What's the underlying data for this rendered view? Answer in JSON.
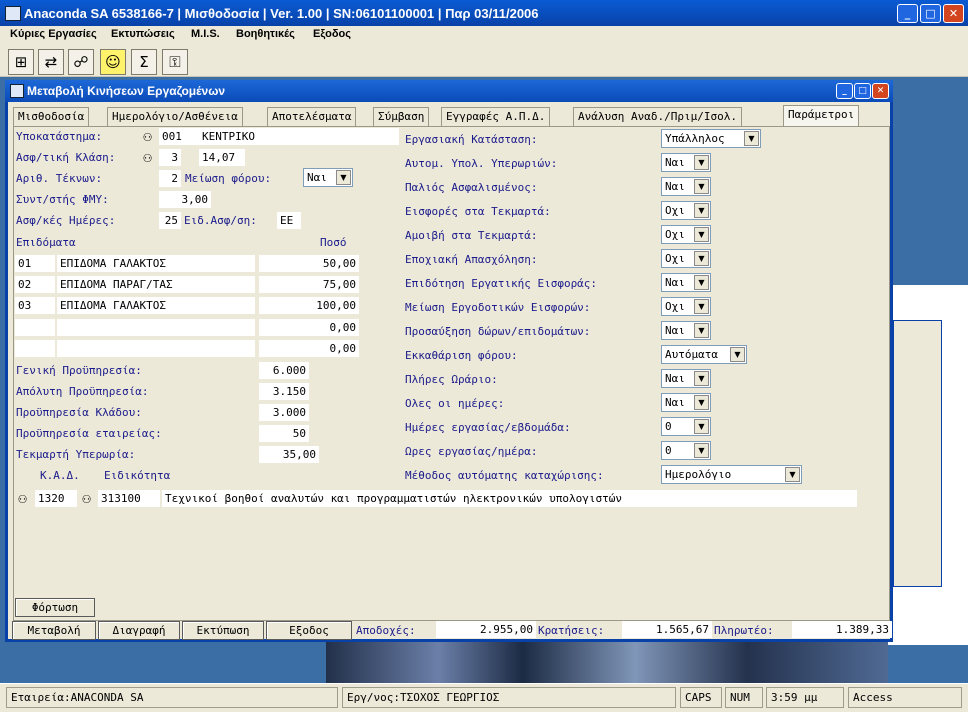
{
  "app": {
    "title": "Anaconda SA 6538166-7 | Μισθοδοσία | Ver. 1.00 | SN:06101100001 | Παρ 03/11/2006"
  },
  "menu": [
    "Κύριες Εργασίες",
    "Εκτυπώσεις",
    "M.I.S.",
    "Βοηθητικές",
    "Εξοδος"
  ],
  "toolbar_icons": [
    "hierarchy-icon",
    "network-icon",
    "tree-icon",
    "smiley-icon",
    "sum-icon",
    "key-icon"
  ],
  "child": {
    "title": "Μεταβολή Κινήσεων Εργαζομένων"
  },
  "tabs": [
    "Μισθοδοσία",
    "Ημερολόγιο/Ασθένεια",
    "Αποτελέσματα",
    "Σύμβαση",
    "Εγγραφές Α.Π.Δ.",
    "Ανάλυση Αναδ./Πριμ/Ισολ.",
    "Παράμετροι"
  ],
  "left": {
    "branch_label": "Υποκατάστημα:",
    "branch_code": "001",
    "branch_name": "ΚΕΝΤΡΙΚΟ",
    "class_label": "Ασφ/τική Κλάση:",
    "class_code": "3",
    "class_value": "14,07",
    "children_label": "Αριθ. Τέκνων:",
    "children_value": "2",
    "tax_red_label": "Μείωση φόρου:",
    "tax_red_value": "Ναι",
    "fmy_label": "Συντ/στής ΦΜΥ:",
    "fmy_value": "3,00",
    "ins_days_label": "Ασφ/κές Ημέρες:",
    "ins_days_value": "25",
    "ins_type_label": "Ειδ.Ασφ/ση:",
    "ins_type_value": "ΕΕ",
    "allow_header": "Επιδόματα",
    "amount_header": "Ποσό",
    "allowances": [
      {
        "code": "01",
        "name": "ΕΠΙΔΟΜΑ ΓΑΛΑΚΤΟΣ",
        "amount": "50,00"
      },
      {
        "code": "02",
        "name": "ΕΠΙΔΟΜΑ ΠΑΡΑΓ/ΤΑΣ",
        "amount": "75,00"
      },
      {
        "code": "03",
        "name": "ΕΠΙΔΟΜΑ ΓΑΛΑΚΤΟΣ",
        "amount": "100,00"
      },
      {
        "code": "",
        "name": "",
        "amount": "0,00"
      },
      {
        "code": "",
        "name": "",
        "amount": "0,00"
      }
    ],
    "general_label": "Γενική Προϋπηρεσία:",
    "general_value": "6.000",
    "absolute_label": "Απόλυτη Προϋπηρεσία:",
    "absolute_value": "3.150",
    "sector_label": "Προϋπηρεσία Κλάδου:",
    "sector_value": "3.000",
    "company_label": "Προϋπηρεσία εταιρείας:",
    "company_value": "50",
    "overtime_label": "Τεκμαρτή Υπερωρία:",
    "overtime_value": "35,00",
    "kad_label": "Κ.Α.Δ.",
    "specialty_label": "Ειδικότητα",
    "kad_code": "1320",
    "specialty_code": "313100",
    "specialty_name": "Τεχνικοί βοηθοί αναλυτών και προγραμματιστών ηλεκτρονικών υπολογιστών"
  },
  "right": [
    {
      "label": "Εργασιακή Κατάσταση:",
      "value": "Υπάλληλος"
    },
    {
      "label": "Αυτομ. Υπολ. Υπερωριών:",
      "value": "Ναι"
    },
    {
      "label": "Παλιός Ασφαλισμένος:",
      "value": "Ναι"
    },
    {
      "label": "Εισφορές στα Τεκμαρτά:",
      "value": "Οχι"
    },
    {
      "label": "Αμοιβή στα Τεκμαρτά:",
      "value": "Οχι"
    },
    {
      "label": "Εποχιακή Απασχόληση:",
      "value": "Οχι"
    },
    {
      "label": "Επιδότηση Εργατικής Εισφοράς:",
      "value": "Ναι"
    },
    {
      "label": "Μείωση Εργοδοτικών Εισφορών:",
      "value": "Οχι"
    },
    {
      "label": "Προσαύξηση δώρων/επιδομάτων:",
      "value": "Ναι"
    },
    {
      "label": "Εκκαθάριση φόρου:",
      "value": "Αυτόματα"
    },
    {
      "label": "Πλήρες Ωράριο:",
      "value": "Ναι"
    },
    {
      "label": "Ολες οι ημέρες:",
      "value": "Ναι"
    },
    {
      "label": "Ημέρες εργασίας/εβδομάδα:",
      "value": "0"
    },
    {
      "label": "Ωρες εργασίας/ημέρα:",
      "value": "0"
    },
    {
      "label": "Μέθοδος αυτόματης καταχώρισης:",
      "value": "Ημερολόγιο"
    }
  ],
  "load_button": "Φόρτωση",
  "bottom": {
    "buttons": [
      "Μεταβολή",
      "Διαγραφή",
      "Εκτύπωση",
      "Εξοδος"
    ],
    "earnings_label": "Αποδοχές:",
    "earnings_value": "2.955,00",
    "deductions_label": "Κρατήσεις:",
    "deductions_value": "1.565,67",
    "payable_label": "Πληρωτέο:",
    "payable_value": "1.389,33"
  },
  "status": {
    "company": "Εταιρεία:ANACONDA SA",
    "employee": "Εργ/νος:ΤΣΟΧΟΣ ΓΕΩΡΓΙΟΣ",
    "caps": "CAPS",
    "num": "NUM",
    "time": "3:59 μμ",
    "db": "Access"
  }
}
